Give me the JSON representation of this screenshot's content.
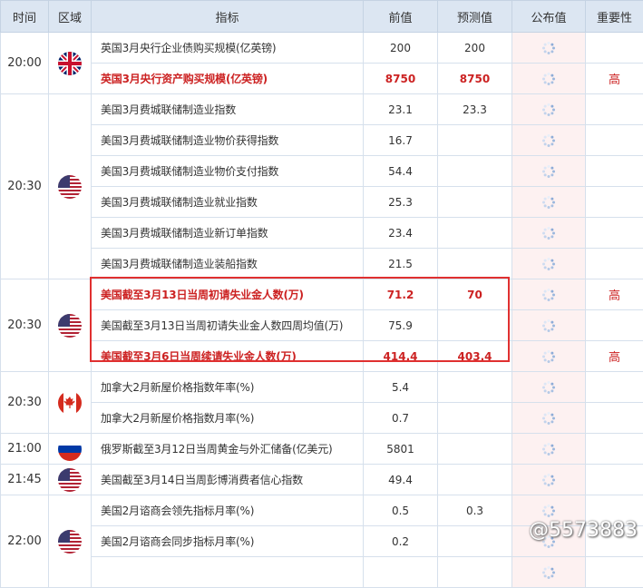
{
  "header": {
    "time": "时间",
    "region": "区域",
    "indicator": "指标",
    "previous": "前值",
    "forecast": "预测值",
    "published": "公布值",
    "importance": "重要性"
  },
  "groups": [
    {
      "time": "20:00",
      "flag": "uk-flag-icon",
      "rows": [
        {
          "indicator": "英国3月央行企业债购买规模(亿英镑)",
          "previous": "200",
          "forecast": "200",
          "importance": "",
          "highlight": false
        },
        {
          "indicator": "英国3月央行资产购买规模(亿英镑)",
          "previous": "8750",
          "forecast": "8750",
          "importance": "高",
          "highlight": true
        }
      ]
    },
    {
      "time": "20:30",
      "flag": "us-flag-icon",
      "rows": [
        {
          "indicator": "美国3月费城联储制造业指数",
          "previous": "23.1",
          "forecast": "23.3",
          "importance": "",
          "highlight": false
        },
        {
          "indicator": "美国3月费城联储制造业物价获得指数",
          "previous": "16.7",
          "forecast": "",
          "importance": "",
          "highlight": false
        },
        {
          "indicator": "美国3月费城联储制造业物价支付指数",
          "previous": "54.4",
          "forecast": "",
          "importance": "",
          "highlight": false
        },
        {
          "indicator": "美国3月费城联储制造业就业指数",
          "previous": "25.3",
          "forecast": "",
          "importance": "",
          "highlight": false
        },
        {
          "indicator": "美国3月费城联储制造业新订单指数",
          "previous": "23.4",
          "forecast": "",
          "importance": "",
          "highlight": false
        },
        {
          "indicator": "美国3月费城联储制造业装船指数",
          "previous": "21.5",
          "forecast": "",
          "importance": "",
          "highlight": false
        }
      ]
    },
    {
      "time": "20:30",
      "flag": "us-flag-icon",
      "rows": [
        {
          "indicator": "美国截至3月13日当周初请失业金人数(万)",
          "previous": "71.2",
          "forecast": "70",
          "importance": "高",
          "highlight": true
        },
        {
          "indicator": "美国截至3月13日当周初请失业金人数四周均值(万)",
          "previous": "75.9",
          "forecast": "",
          "importance": "",
          "highlight": false
        },
        {
          "indicator": "美国截至3月6日当周续请失业金人数(万)",
          "previous": "414.4",
          "forecast": "403.4",
          "importance": "高",
          "highlight": true
        }
      ]
    },
    {
      "time": "20:30",
      "flag": "canada-flag-icon",
      "rows": [
        {
          "indicator": "加拿大2月新屋价格指数年率(%)",
          "previous": "5.4",
          "forecast": "",
          "importance": "",
          "highlight": false
        },
        {
          "indicator": "加拿大2月新屋价格指数月率(%)",
          "previous": "0.7",
          "forecast": "",
          "importance": "",
          "highlight": false
        }
      ]
    },
    {
      "time": "21:00",
      "flag": "russia-flag-icon",
      "rows": [
        {
          "indicator": "俄罗斯截至3月12日当周黄金与外汇储备(亿美元)",
          "previous": "5801",
          "forecast": "",
          "importance": "",
          "highlight": false
        }
      ]
    },
    {
      "time": "21:45",
      "flag": "us-flag-icon",
      "rows": [
        {
          "indicator": "美国截至3月14日当周彭博消费者信心指数",
          "previous": "49.4",
          "forecast": "",
          "importance": "",
          "highlight": false
        }
      ]
    },
    {
      "time": "22:00",
      "flag": "us-flag-icon",
      "rows": [
        {
          "indicator": "美国2月谘商会领先指标月率(%)",
          "previous": "0.5",
          "forecast": "0.3",
          "importance": "",
          "highlight": false
        },
        {
          "indicator": "美国2月谘商会同步指标月率(%)",
          "previous": "0.2",
          "forecast": "",
          "importance": "",
          "highlight": false
        },
        {
          "indicator": "",
          "previous": "",
          "forecast": "",
          "importance": "",
          "highlight": false
        }
      ]
    }
  ],
  "watermark": "@5573883",
  "colors": {
    "highlight": "#cc2222",
    "header_bg": "#dce6f2",
    "published_bg": "#fdf1f1",
    "box": "#e03030"
  }
}
